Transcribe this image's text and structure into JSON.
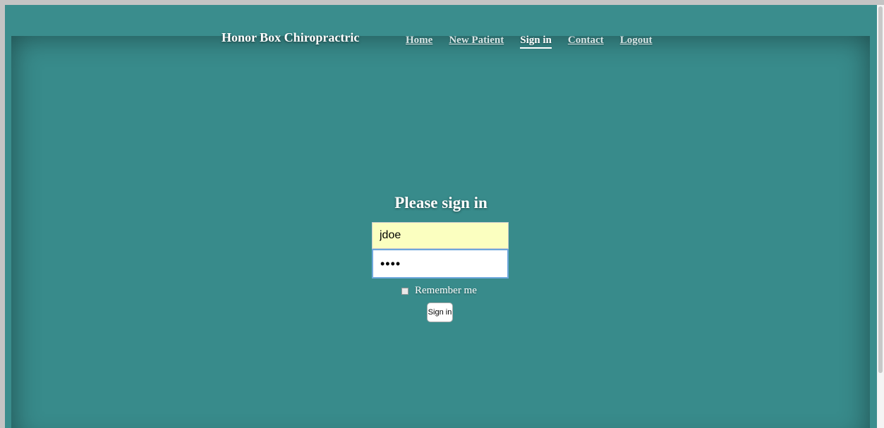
{
  "header": {
    "brand": "Honor Box Chiropractric",
    "nav": [
      {
        "label": "Home"
      },
      {
        "label": "New Patient"
      },
      {
        "label": "Sign in"
      },
      {
        "label": "Contact"
      },
      {
        "label": "Logout"
      }
    ]
  },
  "form": {
    "title": "Please sign in",
    "username_value": "jdoe",
    "password_display": "••••",
    "remember_label": "Remember me",
    "remember_checked": false,
    "submit_label": "Sign in"
  },
  "colors": {
    "background": "#3a8d8d",
    "username_autofill": "#fbffc0",
    "focus_border": "#6fa8dc"
  }
}
